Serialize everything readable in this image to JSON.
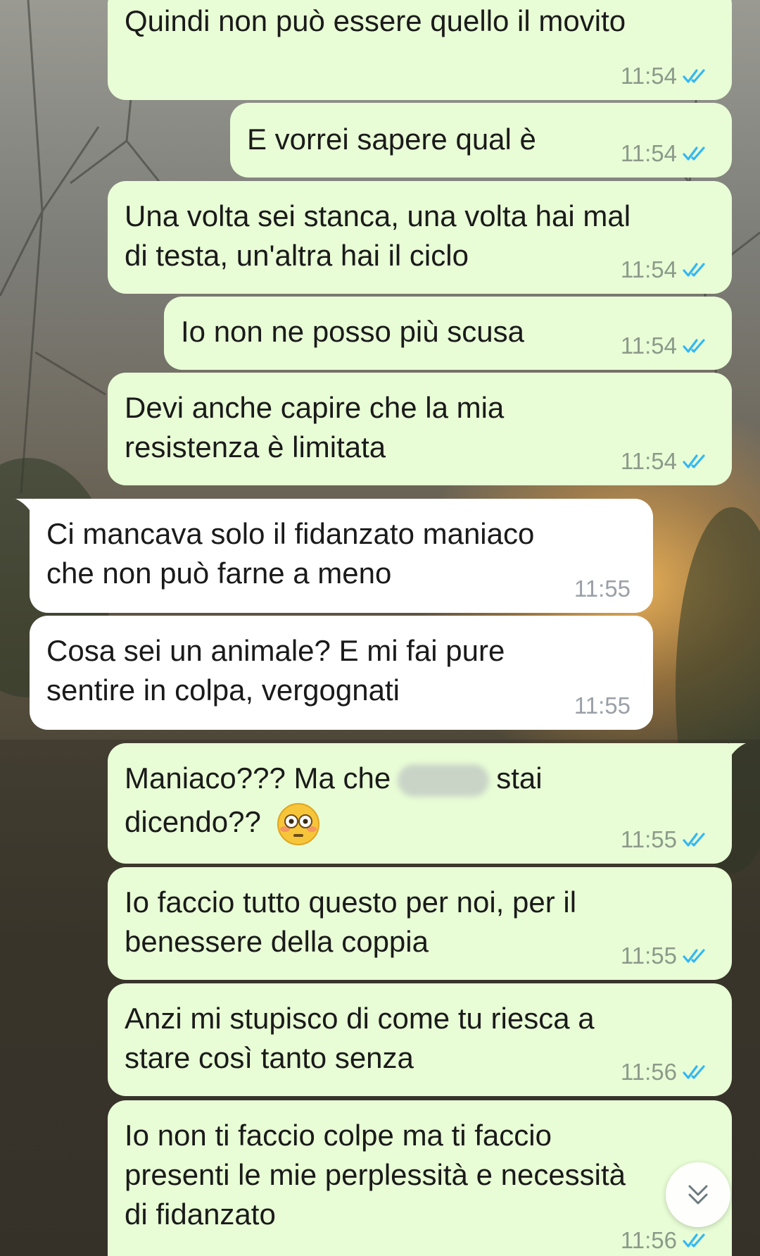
{
  "messages": [
    {
      "lines": [
        "Quindi non può essere quello il movito"
      ],
      "time": "11:54",
      "dir": "out"
    },
    {
      "lines": [
        "E vorrei sapere qual è"
      ],
      "time": "11:54",
      "dir": "out"
    },
    {
      "lines": [
        "Una volta sei stanca, una volta hai mal",
        "di testa, un'altra hai il ciclo"
      ],
      "time": "11:54",
      "dir": "out"
    },
    {
      "lines": [
        "Io non ne posso più scusa"
      ],
      "time": "11:54",
      "dir": "out"
    },
    {
      "lines": [
        "Devi anche capire che la mia",
        "resistenza è limitata"
      ],
      "time": "11:54",
      "dir": "out"
    },
    {
      "lines": [
        "Ci mancava solo il fidanzato maniaco",
        "che non può farne a meno"
      ],
      "time": "11:55",
      "dir": "in"
    },
    {
      "lines": [
        "Cosa sei un animale? E mi fai pure",
        "sentire in colpa, vergognati"
      ],
      "time": "11:55",
      "dir": "in"
    },
    {
      "line1_before": "Maniaco??? Ma che",
      "line1_after": "stai",
      "line2": "dicendo??",
      "time": "11:55",
      "dir": "out",
      "emoji": "flushed-face"
    },
    {
      "lines": [
        "Io faccio tutto questo per noi, per il",
        "benessere della coppia"
      ],
      "time": "11:55",
      "dir": "out"
    },
    {
      "lines": [
        "Anzi mi stupisco di come tu riesca a",
        "stare così tanto senza"
      ],
      "time": "11:56",
      "dir": "out"
    },
    {
      "lines": [
        "Io non ti faccio colpe ma ti faccio",
        "presenti le mie perplessità e necessità",
        "di fidanzato"
      ],
      "time": "11:56",
      "dir": "out"
    }
  ],
  "colors": {
    "outgoing": "#e8fdd6",
    "incoming": "#ffffff",
    "read_ticks": "#34b7f1"
  },
  "icons": {
    "read_receipt": "double-check-icon",
    "scroll_down": "chevron-double-down-icon"
  }
}
